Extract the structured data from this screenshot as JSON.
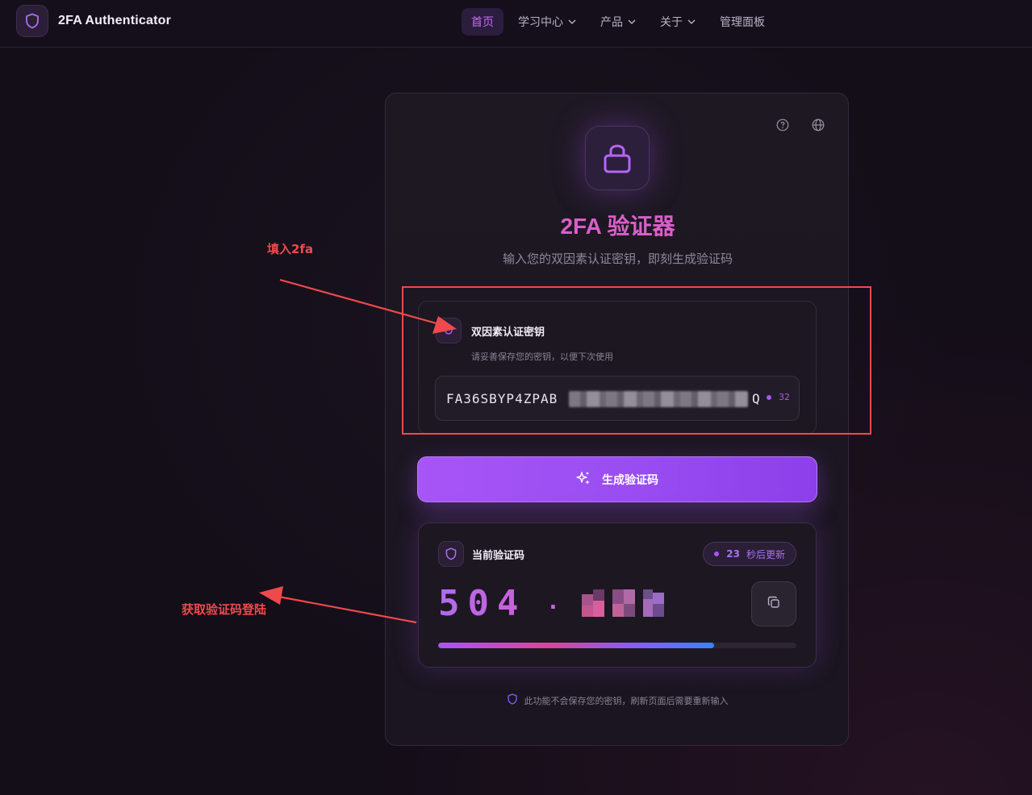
{
  "header": {
    "brand_title": "2FA Authenticator",
    "nav": [
      {
        "label": "首页",
        "active": true,
        "has_dropdown": false
      },
      {
        "label": "学习中心",
        "active": false,
        "has_dropdown": true
      },
      {
        "label": "产品",
        "active": false,
        "has_dropdown": true
      },
      {
        "label": "关于",
        "active": false,
        "has_dropdown": true
      },
      {
        "label": "管理面板",
        "active": false,
        "has_dropdown": false
      }
    ]
  },
  "card": {
    "title": "2FA 验证器",
    "subtitle": "输入您的双因素认证密钥，即刻生成验证码",
    "secret": {
      "label": "双因素认证密钥",
      "hint": "请妥善保存您的密钥，以便下次使用",
      "value_visible": "FA36SBYP4ZPAB",
      "value_tail": "Q",
      "length": "32"
    },
    "generate_button": "生成验证码",
    "code": {
      "label": "当前验证码",
      "timer_value": "23",
      "timer_suffix": "秒后更新",
      "digits": "504",
      "separator": "·",
      "progress_fraction": 0.77
    },
    "footer_note": "此功能不会保存您的密钥，刷新页面后需要重新输入"
  },
  "annotations": {
    "fill_label": "填入2fa",
    "get_label": "获取验证码登陆"
  },
  "colors": {
    "accent": "#a855f7",
    "title": "#d95fc9",
    "annotation": "#f0494d"
  }
}
